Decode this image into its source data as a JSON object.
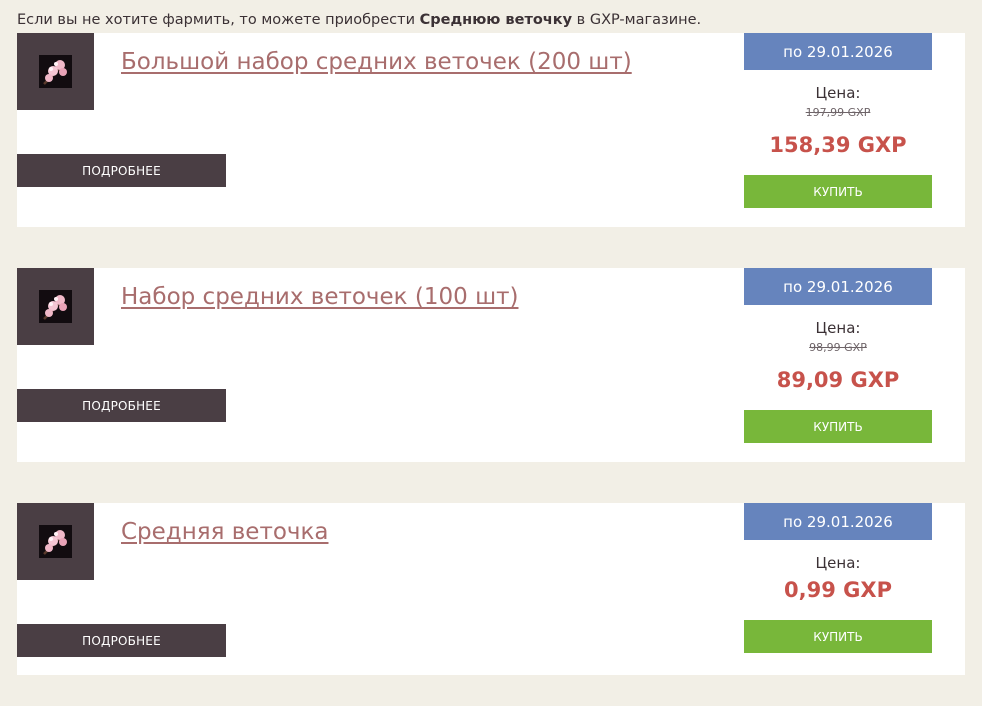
{
  "intro": {
    "before": "Если вы не хотите фармить, то можете приобрести ",
    "bold": "Среднюю веточку",
    "after": " в GXP-магазине."
  },
  "colors": {
    "background": "#f2efe6",
    "title_link": "#a86d6d",
    "date_badge": "#6684bd",
    "price": "#c7524b",
    "buy_button": "#78b73a",
    "details_button": "#4a3e44"
  },
  "products": [
    {
      "icon": "blossom-branch-icon",
      "title": "Большой набор средних веточек (200 шт)",
      "details_label": "ПОДРОБНЕЕ",
      "date": "по 29.01.2026",
      "price_label": "Цена:",
      "old_price": "197,99 GXP",
      "price": "158,39 GXP",
      "buy_label": "КУПИТЬ"
    },
    {
      "icon": "blossom-branch-icon",
      "title": "Набор средних веточек (100 шт)",
      "details_label": "ПОДРОБНЕЕ",
      "date": "по 29.01.2026",
      "price_label": "Цена:",
      "old_price": "98,99 GXP",
      "price": "89,09 GXP",
      "buy_label": "КУПИТЬ"
    },
    {
      "icon": "blossom-branch-icon",
      "title": "Средняя веточка",
      "details_label": "ПОДРОБНЕЕ",
      "date": "по 29.01.2026",
      "price_label": "Цена:",
      "price": "0,99 GXP",
      "buy_label": "КУПИТЬ"
    }
  ]
}
